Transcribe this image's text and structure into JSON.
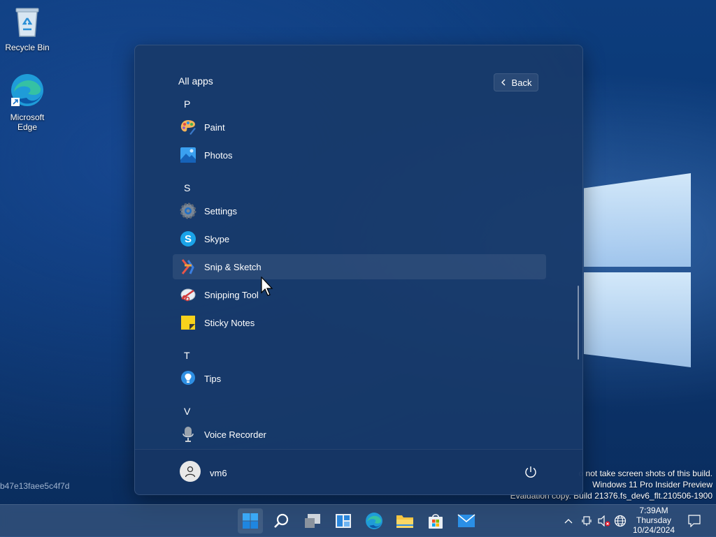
{
  "desktop": {
    "icons": [
      {
        "label": "Recycle Bin"
      },
      {
        "label": "Microsoft Edge"
      }
    ],
    "hash_text": "b47e13faee5c4f7d",
    "watermark": {
      "line1": "o not take screen shots of this build.",
      "line2": "Windows 11 Pro Insider Preview",
      "line3": "Evaluation copy. Build 21376.fs_dev6_flt.210506-1900"
    }
  },
  "start_menu": {
    "title": "All apps",
    "back_label": "Back",
    "items": [
      {
        "type": "letter",
        "label": "P"
      },
      {
        "type": "app",
        "label": "Paint",
        "icon": "paint-icon"
      },
      {
        "type": "app",
        "label": "Photos",
        "icon": "photos-icon"
      },
      {
        "type": "letter",
        "label": "S"
      },
      {
        "type": "app",
        "label": "Settings",
        "icon": "settings-icon"
      },
      {
        "type": "app",
        "label": "Skype",
        "icon": "skype-icon"
      },
      {
        "type": "app",
        "label": "Snip & Sketch",
        "icon": "snip-sketch-icon",
        "hovered": true
      },
      {
        "type": "app",
        "label": "Snipping Tool",
        "icon": "snipping-tool-icon"
      },
      {
        "type": "app",
        "label": "Sticky Notes",
        "icon": "sticky-notes-icon"
      },
      {
        "type": "letter",
        "label": "T"
      },
      {
        "type": "app",
        "label": "Tips",
        "icon": "tips-icon"
      },
      {
        "type": "letter",
        "label": "V"
      },
      {
        "type": "app",
        "label": "Voice Recorder",
        "icon": "voice-recorder-icon"
      }
    ],
    "user": {
      "name": "vm6"
    }
  },
  "taskbar": {
    "buttons": [
      "start-icon",
      "search-icon",
      "task-view-icon",
      "widgets-icon",
      "edge-icon",
      "file-explorer-icon",
      "store-icon",
      "mail-icon"
    ],
    "clock": {
      "time": "7:39AM",
      "day": "Thursday",
      "date": "10/24/2024"
    }
  },
  "colors": {
    "accent": "#0078d4",
    "start_bg": "#183a69"
  }
}
